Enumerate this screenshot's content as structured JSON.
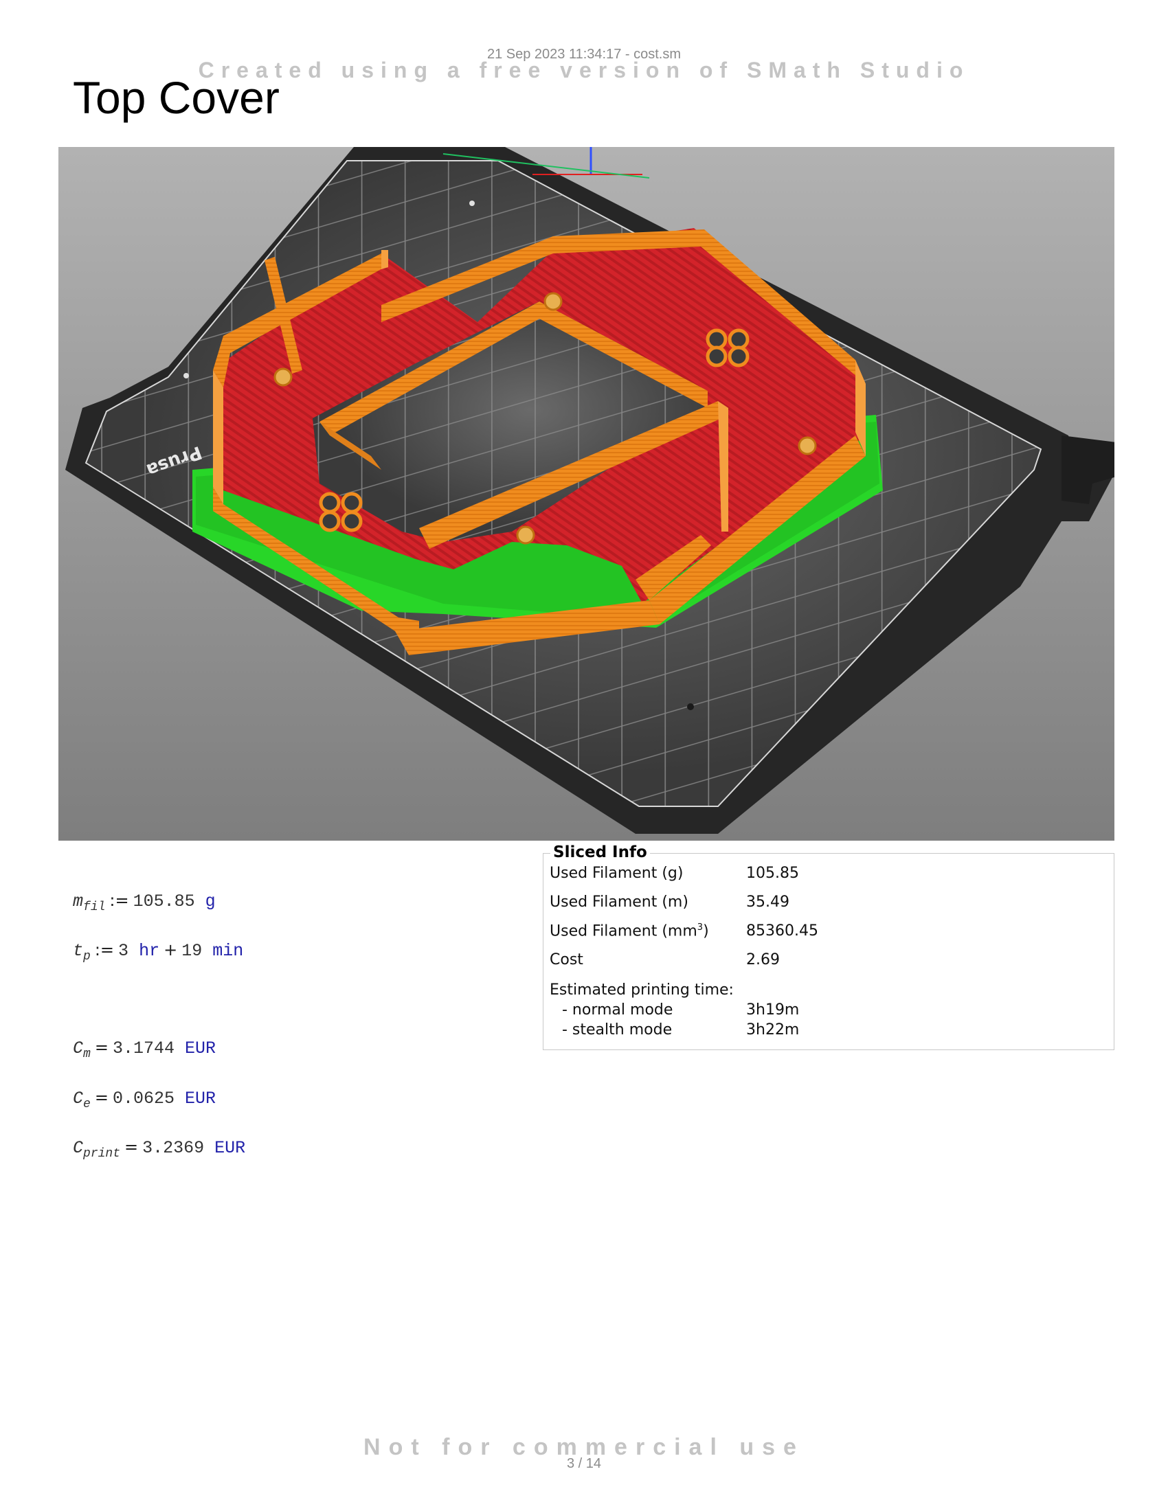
{
  "header": {
    "date_file": "21 Sep 2023 11:34:17 - cost.sm",
    "watermark_top": "Created using a free version of SMath Studio"
  },
  "footer": {
    "watermark_bottom": "Not for commercial use",
    "page_number": "3 / 14"
  },
  "title": "Top Cover",
  "viewport": {
    "bed_text": "Prusa"
  },
  "math": {
    "m_fil": {
      "var": "m",
      "sub": "fil",
      "op": ":=",
      "value": "105.85",
      "unit": "g"
    },
    "t_p": {
      "var": "t",
      "sub": "p",
      "op": ":=",
      "v1": "3",
      "u1": "hr",
      "plus": "+",
      "v2": "19",
      "u2": "min"
    },
    "c_m": {
      "var": "C",
      "sub": "m",
      "op": "=",
      "value": "3.1744",
      "unit": "EUR"
    },
    "c_e": {
      "var": "C",
      "sub": "e",
      "op": "=",
      "value": "0.0625",
      "unit": "EUR"
    },
    "c_print": {
      "var": "C",
      "sub": "print",
      "op": "=",
      "value": "3.2369",
      "unit": "EUR"
    }
  },
  "sliced_info": {
    "legend": "Sliced Info",
    "rows": [
      {
        "label": "Used Filament (g)",
        "value": "105.85"
      },
      {
        "label": "Used Filament (m)",
        "value": "35.49"
      },
      {
        "label_pre": "Used Filament (mm",
        "label_sup": "3",
        "label_post": ")",
        "value": "85360.45"
      },
      {
        "label": "Cost",
        "value": "2.69"
      },
      {
        "label": "Estimated printing time:",
        "value": ""
      },
      {
        "label": "- normal mode",
        "value": "3h19m"
      },
      {
        "label": "- stealth mode",
        "value": "3h22m"
      }
    ]
  },
  "colors": {
    "print_orange": "#f08c1e",
    "infill_red": "#d8242a",
    "support_green": "#28e028",
    "bed_dark": "#2c2c2c",
    "unit_blue": "#2222aa"
  }
}
